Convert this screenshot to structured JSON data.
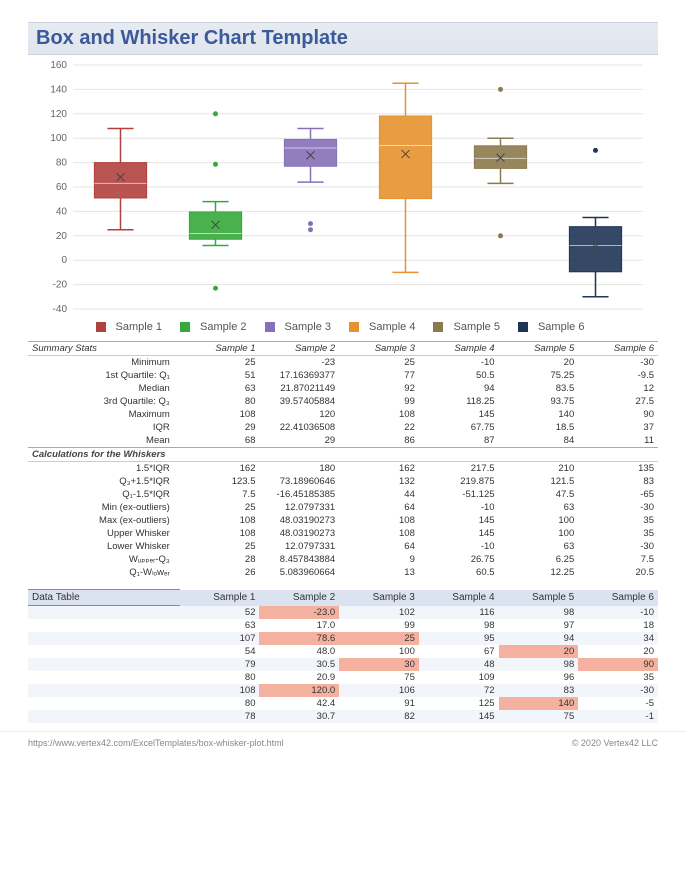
{
  "title": "Box and Whisker Chart Template",
  "legend_prefix": "Sample",
  "samples": [
    "Sample 1",
    "Sample 2",
    "Sample 3",
    "Sample 4",
    "Sample 5",
    "Sample 6"
  ],
  "colors": [
    "#b0413e",
    "#37a93c",
    "#8670b7",
    "#e6922e",
    "#8c7a4e",
    "#1f3555"
  ],
  "chart_data": {
    "type": "boxplot",
    "ylim": [
      -40,
      160
    ],
    "yticks": [
      -40,
      -20,
      0,
      20,
      40,
      60,
      80,
      100,
      120,
      140,
      160
    ],
    "series": [
      {
        "name": "Sample 1",
        "min": 25,
        "q1": 51,
        "median": 63,
        "q3": 80,
        "max": 108,
        "whisker_lo": 25,
        "whisker_hi": 108,
        "mean": 68,
        "outliers": []
      },
      {
        "name": "Sample 2",
        "min": -23,
        "q1": 17.16369377,
        "median": 21.87021149,
        "q3": 39.57405884,
        "max": 120,
        "whisker_lo": 12.0797331,
        "whisker_hi": 48.03190273,
        "mean": 29,
        "outliers": [
          -23,
          78.6,
          120
        ]
      },
      {
        "name": "Sample 3",
        "min": 25,
        "q1": 77,
        "median": 92,
        "q3": 99,
        "max": 108,
        "whisker_lo": 64,
        "whisker_hi": 108,
        "mean": 86,
        "outliers": [
          25,
          30
        ]
      },
      {
        "name": "Sample 4",
        "min": -10,
        "q1": 50.5,
        "median": 94,
        "q3": 118.25,
        "max": 145,
        "whisker_lo": -10,
        "whisker_hi": 145,
        "mean": 87,
        "outliers": []
      },
      {
        "name": "Sample 5",
        "min": 20,
        "q1": 75.25,
        "median": 83.5,
        "q3": 93.75,
        "max": 140,
        "whisker_lo": 63,
        "whisker_hi": 100,
        "mean": 84,
        "outliers": [
          20,
          140
        ]
      },
      {
        "name": "Sample 6",
        "min": -30,
        "q1": -9.5,
        "median": 12,
        "q3": 27.5,
        "max": 90,
        "whisker_lo": -30,
        "whisker_hi": 35,
        "mean": 11,
        "outliers": [
          90
        ]
      }
    ]
  },
  "summary_header": "Summary Stats",
  "summary_rows": [
    {
      "label": "Minimum",
      "vals": [
        "25",
        "-23",
        "25",
        "-10",
        "20",
        "-30"
      ]
    },
    {
      "label": "1st Quartile: Q₁",
      "vals": [
        "51",
        "17.16369377",
        "77",
        "50.5",
        "75.25",
        "-9.5"
      ]
    },
    {
      "label": "Median",
      "vals": [
        "63",
        "21.87021149",
        "92",
        "94",
        "83.5",
        "12"
      ]
    },
    {
      "label": "3rd Quartile: Q₃",
      "vals": [
        "80",
        "39.57405884",
        "99",
        "118.25",
        "93.75",
        "27.5"
      ]
    },
    {
      "label": "Maximum",
      "vals": [
        "108",
        "120",
        "108",
        "145",
        "140",
        "90"
      ]
    },
    {
      "label": "IQR",
      "vals": [
        "29",
        "22.41036508",
        "22",
        "67.75",
        "18.5",
        "37"
      ]
    },
    {
      "label": "Mean",
      "vals": [
        "68",
        "29",
        "86",
        "87",
        "84",
        "11"
      ]
    }
  ],
  "calc_header": "Calculations for the Whiskers",
  "calc_rows": [
    {
      "label": "1.5*IQR",
      "vals": [
        "162",
        "180",
        "162",
        "217.5",
        "210",
        "135"
      ]
    },
    {
      "label": "Q₃+1.5*IQR",
      "vals": [
        "123.5",
        "73.18960646",
        "132",
        "219.875",
        "121.5",
        "83"
      ]
    },
    {
      "label": "Q₁-1.5*IQR",
      "vals": [
        "7.5",
        "-16.45185385",
        "44",
        "-51.125",
        "47.5",
        "-65"
      ]
    },
    {
      "label": "Min (ex-outliers)",
      "vals": [
        "25",
        "12.0797331",
        "64",
        "-10",
        "63",
        "-30"
      ]
    },
    {
      "label": "Max (ex-outliers)",
      "vals": [
        "108",
        "48.03190273",
        "108",
        "145",
        "100",
        "35"
      ]
    },
    {
      "label": "Upper Whisker",
      "vals": [
        "108",
        "48.03190273",
        "108",
        "145",
        "100",
        "35"
      ]
    },
    {
      "label": "Lower Whisker",
      "vals": [
        "25",
        "12.0797331",
        "64",
        "-10",
        "63",
        "-30"
      ]
    },
    {
      "label": "Wᵤₚₚₑᵣ-Q₃",
      "vals": [
        "28",
        "8.457843884",
        "9",
        "26.75",
        "6.25",
        "7.5"
      ]
    },
    {
      "label": "Q₁-Wₗₒwₑᵣ",
      "vals": [
        "26",
        "5.083960664",
        "13",
        "60.5",
        "12.25",
        "20.5"
      ]
    }
  ],
  "data_table_header": "Data Table",
  "data_rows": [
    [
      {
        "v": "52"
      },
      {
        "v": "-23.0",
        "hl": true
      },
      {
        "v": "102"
      },
      {
        "v": "116"
      },
      {
        "v": "98"
      },
      {
        "v": "-10"
      }
    ],
    [
      {
        "v": "63"
      },
      {
        "v": "17.0"
      },
      {
        "v": "99"
      },
      {
        "v": "98"
      },
      {
        "v": "97"
      },
      {
        "v": "18"
      }
    ],
    [
      {
        "v": "107"
      },
      {
        "v": "78.6",
        "hl": true
      },
      {
        "v": "25",
        "hl": true
      },
      {
        "v": "95"
      },
      {
        "v": "94"
      },
      {
        "v": "34"
      }
    ],
    [
      {
        "v": "54"
      },
      {
        "v": "48.0"
      },
      {
        "v": "100"
      },
      {
        "v": "67"
      },
      {
        "v": "20",
        "hl": true
      },
      {
        "v": "20"
      }
    ],
    [
      {
        "v": "79"
      },
      {
        "v": "30.5"
      },
      {
        "v": "30",
        "hl": true
      },
      {
        "v": "48"
      },
      {
        "v": "98"
      },
      {
        "v": "90",
        "hl": true
      }
    ],
    [
      {
        "v": "80"
      },
      {
        "v": "20.9"
      },
      {
        "v": "75"
      },
      {
        "v": "109"
      },
      {
        "v": "96"
      },
      {
        "v": "35"
      }
    ],
    [
      {
        "v": "108"
      },
      {
        "v": "120.0",
        "hl": true
      },
      {
        "v": "106"
      },
      {
        "v": "72"
      },
      {
        "v": "83"
      },
      {
        "v": "-30"
      }
    ],
    [
      {
        "v": "80"
      },
      {
        "v": "42.4"
      },
      {
        "v": "91"
      },
      {
        "v": "125"
      },
      {
        "v": "140",
        "hl": true
      },
      {
        "v": "-5"
      }
    ],
    [
      {
        "v": "78"
      },
      {
        "v": "30.7"
      },
      {
        "v": "82"
      },
      {
        "v": "145"
      },
      {
        "v": "75"
      },
      {
        "v": "-1"
      }
    ]
  ],
  "footer_left": "https://www.vertex42.com/ExcelTemplates/box-whisker-plot.html",
  "footer_right": "© 2020 Vertex42 LLC"
}
